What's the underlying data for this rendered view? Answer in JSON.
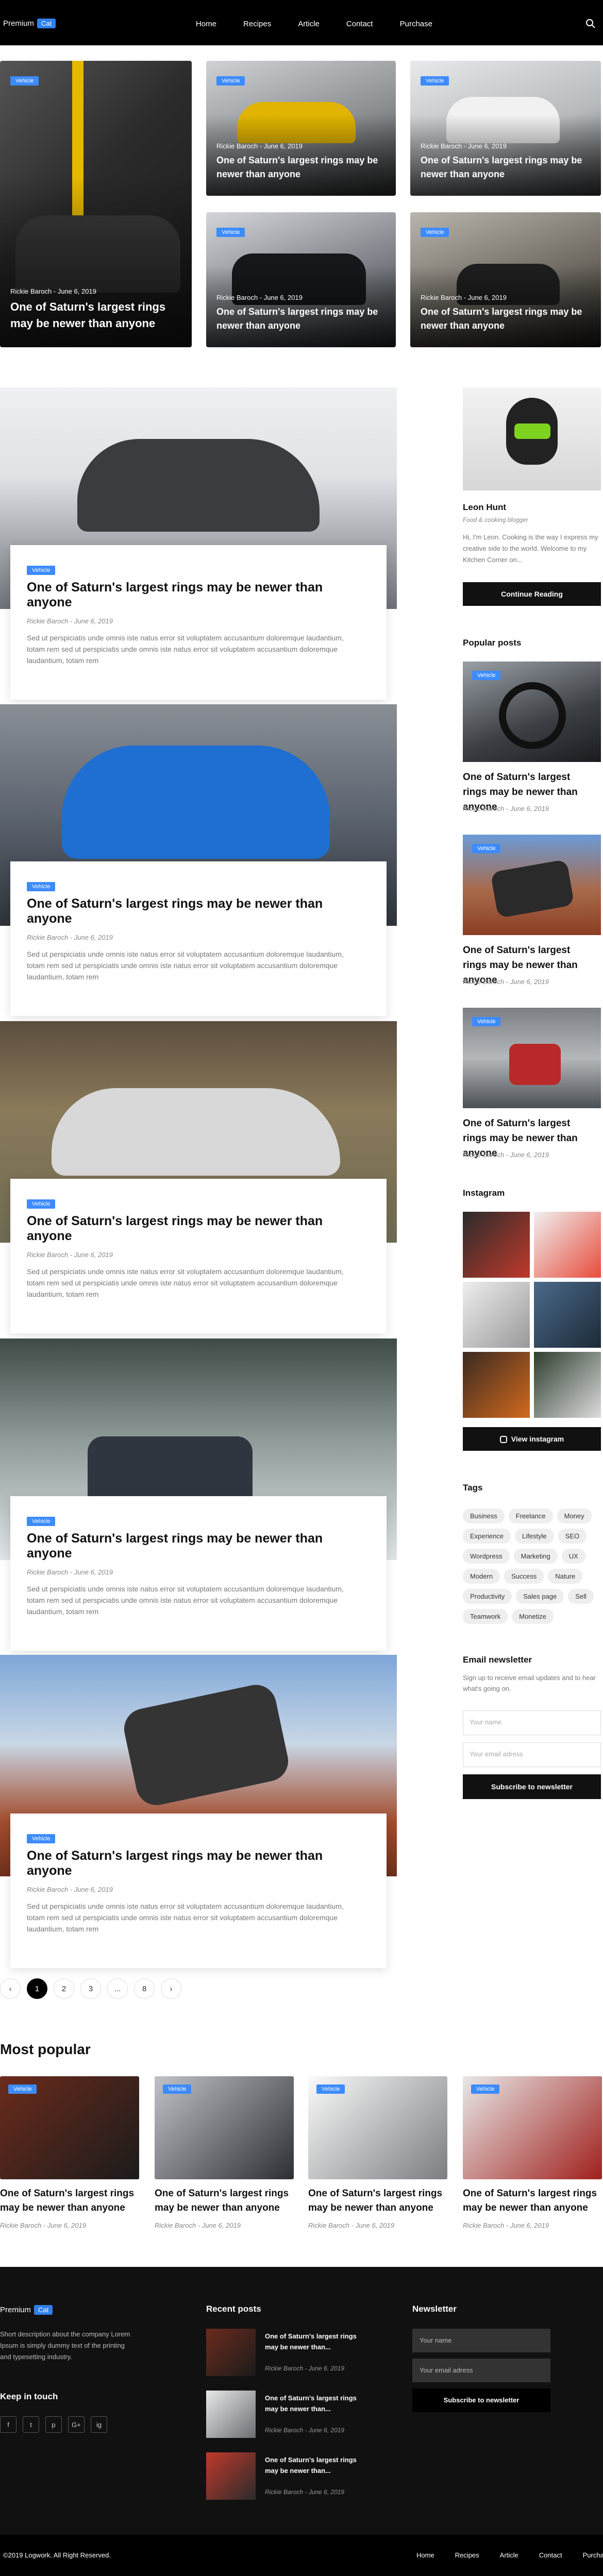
{
  "header": {
    "brand": "Premium",
    "brand_badge": "Cat",
    "nav": [
      "Home",
      "Recipes",
      "Article",
      "Contact",
      "Purchase"
    ],
    "search_icon": "search-icon"
  },
  "featured": {
    "badge": "Vehicle",
    "meta": "Rickie Baroch - June 6, 2019",
    "title": "One of Saturn's largest rings may be newer than anyone"
  },
  "posts": {
    "badge": "Vehicle",
    "title": "One of Saturn's largest rings may be newer than anyone",
    "meta": "Rickie Baroch - June 6, 2019",
    "excerpt": "Sed ut perspiciatis unde omnis iste natus error sit voluptatem accusantium doloremque laudantium, totam rem sed ut perspiciatis unde omnis iste natus error sit voluptatem accusantium doloremque laudantium, totam rem"
  },
  "author": {
    "name": "Leon Hunt",
    "role": "Food & cooking blogger",
    "bio": "Hi, I'm Leon. Cooking is the way I express my creative side to the world. Welcome to my Kitchen Corner on...",
    "button": "Continue Reading"
  },
  "popular": {
    "heading": "Popular posts",
    "badge": "Vehicle",
    "title": "One of Saturn's largest rings may be newer than anyone",
    "meta": "Rickie Baroch - June 6, 2019"
  },
  "instagram": {
    "heading": "Instagram",
    "button": "View instagram"
  },
  "tags": {
    "heading": "Tags",
    "items": [
      "Business",
      "Freelance",
      "Money",
      "Experience",
      "Lifestyle",
      "SEO",
      "Wordpress",
      "Marketing",
      "UX",
      "Modern",
      "Success",
      "Nature",
      "Productivity",
      "Sales page",
      "Sell",
      "Teamwork",
      "Monetize"
    ]
  },
  "newsletter": {
    "heading": "Email newsletter",
    "text": "Sign up to receive email updates and to hear what's going on.",
    "name_placeholder": "Your name",
    "email_placeholder": "Your email adress",
    "button": "Subscribe to newsletter"
  },
  "pagination": [
    "1",
    "2",
    "3",
    "...",
    "8"
  ],
  "most_popular": {
    "heading": "Most popular",
    "badge": "Vehicle",
    "title": "One of Saturn's largest rings may be newer than anyone",
    "meta": "Rickie Baroch - June 6, 2019"
  },
  "footer": {
    "brand": "Premium",
    "brand_badge": "Cat",
    "description": "Short description about the company Lorem Ipsum is simply dummy text of the printing and typesetting industry.",
    "keep_in_touch": "Keep in touch",
    "social": [
      "f",
      "t",
      "p",
      "G+",
      "ig"
    ],
    "recent_heading": "Recent posts",
    "recent_title": "One of Saturn's largest rings may be newer than...",
    "recent_meta": "Rickie Baroch - June 6, 2019",
    "newsletter_heading": "Newsletter",
    "name_placeholder": "Your name",
    "email_placeholder": "Your email adress",
    "subscribe": "Subscribe to newsletter"
  },
  "copyright": "©2019 Logwork. All Right Reserved.",
  "bottom_nav": [
    "Home",
    "Recipes",
    "Article",
    "Contact",
    "Purchase"
  ]
}
